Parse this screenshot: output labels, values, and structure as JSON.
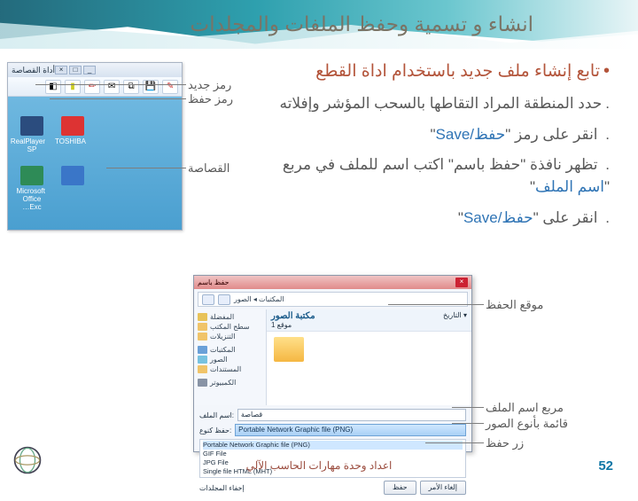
{
  "slide": {
    "title": "انشاء و تسمية وحفظ الملفات والمجلدات",
    "bullet_main": "تابع إنشاء ملف جديد باستخدام اداة القطع",
    "b1a": "حدد المنطقة المراد التقاطها بالسحب المؤشر وإفلاته",
    "b2_pre": "انقر على رمز \"",
    "b2_kw": "حفظ/Save",
    "b2_post": "\"",
    "b3_pre": "تظهر نافذة \"حفظ باسم\" اكتب اسم للملف في مربع \"",
    "b3_kw": "اسم الملف",
    "b3_post": "\"",
    "b4_pre": "انقر على \"",
    "b4_kw": "حفظ/Save",
    "b4_post": "\""
  },
  "labels": {
    "new_icon": "رمز جديد",
    "save_icon": "رمز حفظ",
    "snip_area": "القصاصة",
    "save_location": "موقع الحفظ",
    "filename_box": "مربع اسم الملف",
    "types_list": "قائمة بأنوع الصور",
    "save_btn": "زر حفظ"
  },
  "snip": {
    "title": "أداة القصاصة"
  },
  "desktop": {
    "icon1": "RealPlayer SP",
    "icon2": "TOSHIBA",
    "icon3": "Microsoft Office Exc…"
  },
  "dialog": {
    "title": "حفظ باسم",
    "crumb": "المكتبات ◂ الصور",
    "side": [
      "المفضلة",
      "…",
      "سطح المكتب",
      "التنزيلات",
      "المكتبات",
      "الصور",
      "المستندات",
      "الكمبيوتر"
    ],
    "lib_title": "مكتبة الصور",
    "lib_sub": "1 موقع",
    "col": "التاريخ ▾",
    "filename_lbl": "اسم الملف:",
    "filename_val": "قصاصة",
    "type_lbl": "حفظ كنوع:",
    "type_val": "Portable Network Graphic file (PNG)",
    "opts": [
      "Portable Network Graphic file (PNG)",
      "GIF File",
      "JPG File",
      "Single file HTML (MHT)"
    ],
    "save": "حفظ",
    "cancel": "إلغاء الأمر",
    "hide": "إخفاء المجلدات"
  },
  "footer": {
    "credit": "اعداد وحدة مهارات الحاسب الآلي",
    "page": "52"
  }
}
